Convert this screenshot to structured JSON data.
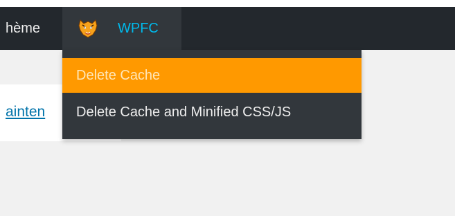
{
  "adminbar": {
    "theme_item_label": "hème",
    "wpfc_item": {
      "label": "WPFC",
      "icon": "tiger-logo-icon"
    }
  },
  "dropdown": {
    "items": [
      {
        "label": "Delete Cache",
        "highlighted": true
      },
      {
        "label": "Delete Cache and Minified CSS/JS",
        "highlighted": false
      }
    ]
  },
  "page": {
    "link_text": "ainten"
  },
  "colors": {
    "adminbar_bg": "#23282d",
    "submenu_bg": "#32373c",
    "highlight": "#ff9900",
    "wpfc_label": "#00b9eb",
    "link": "#0073aa",
    "page_bg": "#f1f1f1"
  }
}
